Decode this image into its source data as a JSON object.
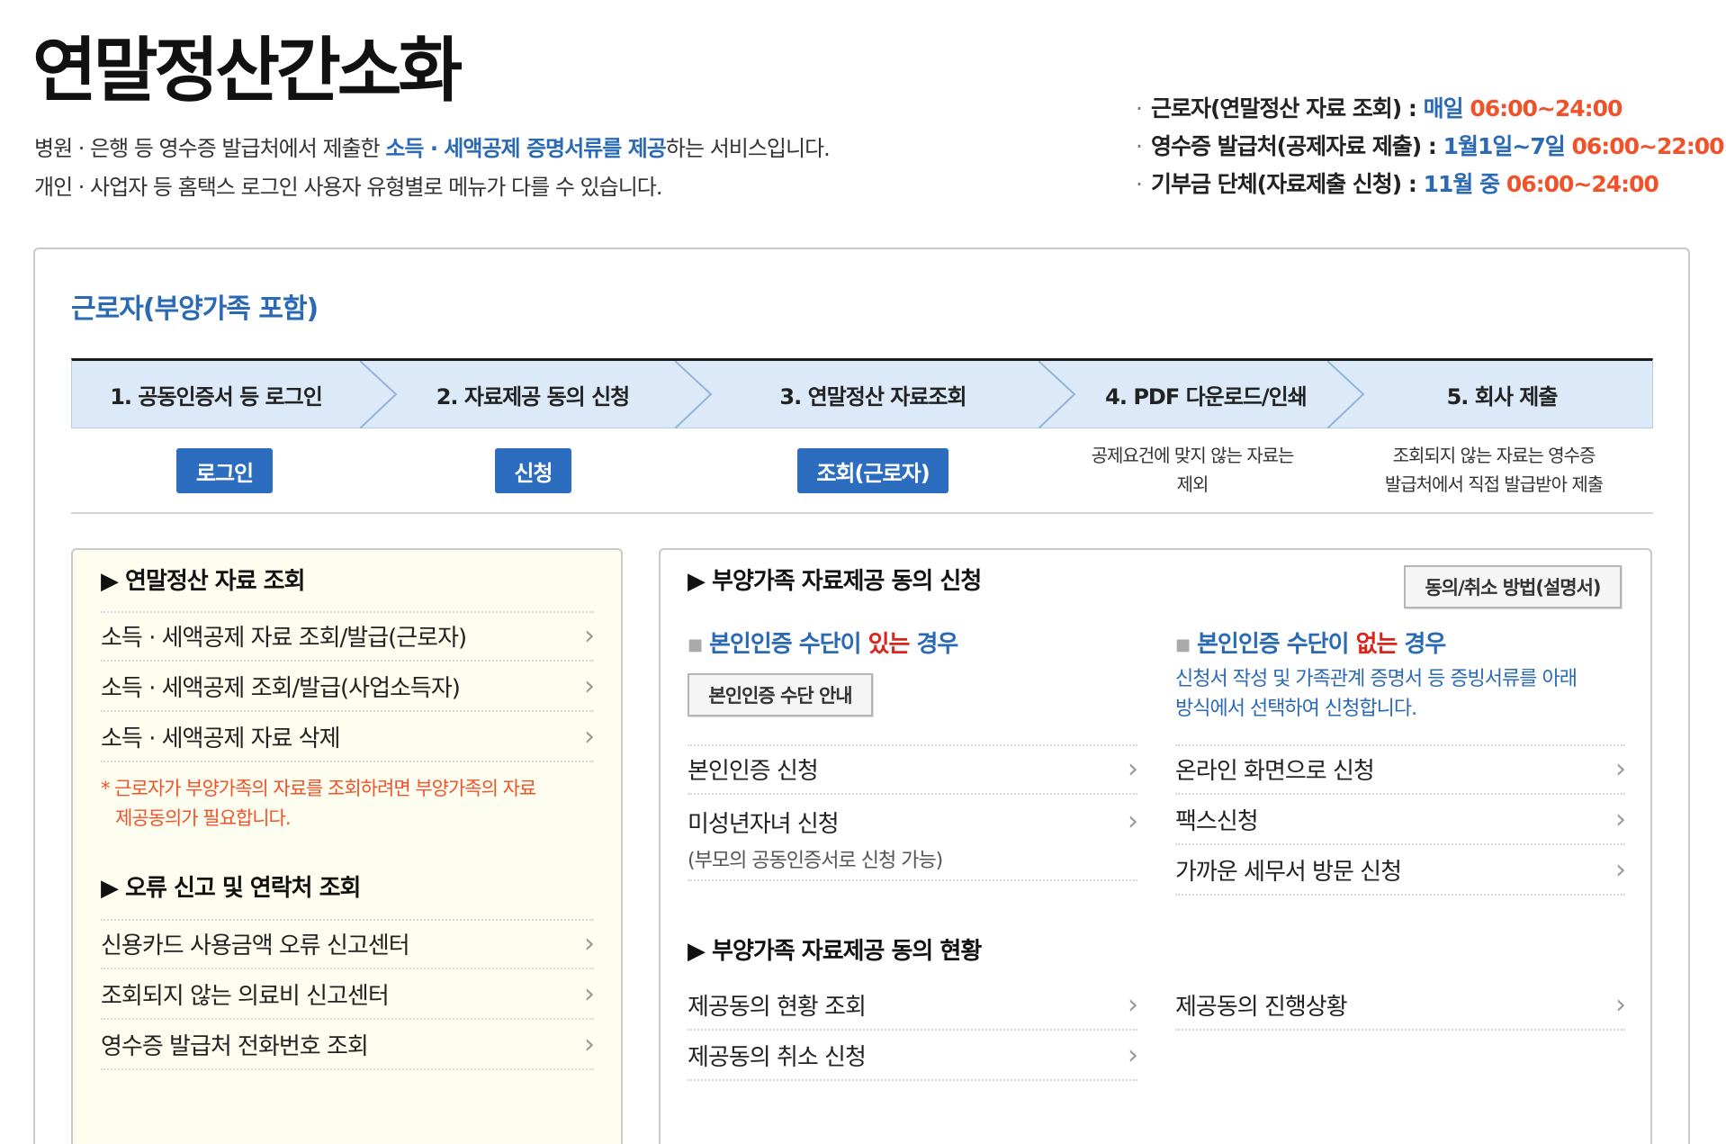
{
  "page": {
    "title": "연말정산간소화",
    "intro_line1_pre": "병원 · 은행 등 영수증 발급처에서 제출한 ",
    "intro_line1_highlight": "소득 · 세액공제 증명서류를 제공",
    "intro_line1_post": "하는 서비스입니다.",
    "intro_line2": "개인 · 사업자 등 홈택스 로그인 사용자 유형별로 메뉴가 다를 수 있습니다."
  },
  "hours": [
    {
      "label": "근로자(연말정산 자료 조회) : ",
      "days": "매일",
      "time": " 06:00~24:00"
    },
    {
      "label": "영수증 발급처(공제자료 제출) : ",
      "days": "1월1일~7일",
      "time": " 06:00~22:00"
    },
    {
      "label": "기부금 단체(자료제출 신청) : ",
      "days": "11월 중",
      "time": " 06:00~24:00"
    }
  ],
  "hours_bullet": "·",
  "section_title": "근로자(부양가족 포함)",
  "steps": [
    {
      "label": "1. 공동인증서 등 로그인",
      "button": "로그인"
    },
    {
      "label": "2. 자료제공 동의 신청",
      "button": "신청"
    },
    {
      "label": "3. 연말정산 자료조회",
      "button": "조회(근로자)"
    },
    {
      "label": "4. PDF 다운로드/인쇄",
      "note_line1": "공제요건에 맞지 않는 자료는",
      "note_line2": "제외"
    },
    {
      "label": "5. 회사 제출",
      "note_line1": "조회되지 않는 자료는 영수증",
      "note_line2": "발급처에서 직접 발급받아 제출"
    }
  ],
  "left": {
    "heading1": "▶ 연말정산 자료 조회",
    "items1": [
      "소득 · 세액공제 자료 조회/발급(근로자)",
      "소득 · 세액공제 조회/발급(사업소득자)",
      "소득 · 세액공제 자료 삭제"
    ],
    "note_line1": "*  근로자가 부양가족의 자료를 조회하려면 부양가족의 자료",
    "note_line2": "제공동의가 필요합니다.",
    "heading2": "▶ 오류 신고 및 연락처 조회",
    "items2": [
      "신용카드 사용금액 오류 신고센터",
      "조회되지 않는 의료비 신고센터",
      "영수증 발급처 전화번호 조회"
    ]
  },
  "right": {
    "heading1": "▶ 부양가족 자료제공 동의 신청",
    "guide_button": "동의/취소 방법(설명서)",
    "with_auth": {
      "pre": "본인인증 수단이 ",
      "mark": "있는",
      "post": " 경우"
    },
    "auth_guide_button": "본인인증 수단 안내",
    "with_items": [
      {
        "label": "본인인증 신청"
      },
      {
        "label": "미성년자녀 신청",
        "note": "(부모의 공동인증서로 신청 가능)"
      }
    ],
    "without_auth": {
      "pre": "본인인증 수단이 ",
      "mark": "없는",
      "post": " 경우"
    },
    "without_desc_line1": "신청서 작성 및 가족관계 증명서 등 증빙서류를 아래",
    "without_desc_line2": "방식에서 선택하여 신청합니다.",
    "without_items": [
      "온라인 화면으로 신청",
      "팩스신청",
      "가까운 세무서 방문 신청"
    ],
    "heading2": "▶ 부양가족 자료제공 동의 현황",
    "status_items_left": [
      "제공동의 현황 조회",
      "제공동의 취소 신청"
    ],
    "status_items_right": [
      "제공동의 진행상황"
    ]
  },
  "chevron": "›",
  "sub_bullet": "■",
  "colors": {
    "accent_blue": "#2a6ab5",
    "button_blue": "#2d6dbf",
    "orange": "#f0522a",
    "red": "#d9261c",
    "step_bg": "#dce9f8",
    "left_box_bg": "#fefef0"
  }
}
